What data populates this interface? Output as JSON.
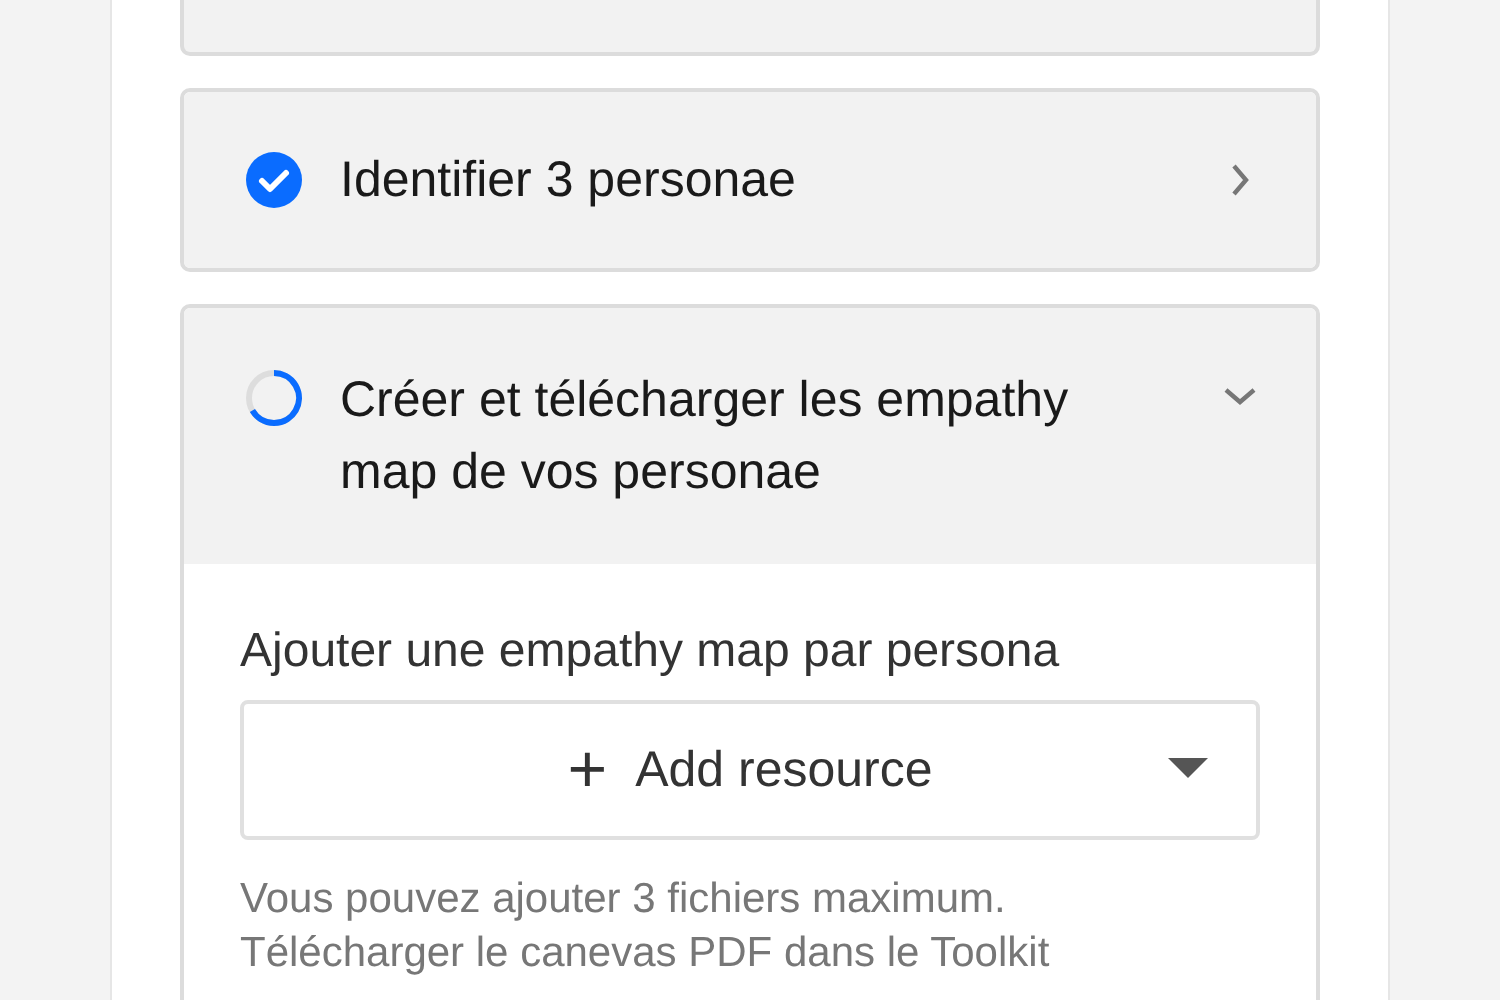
{
  "tasks": [
    {
      "title": "Identifier 3 personae",
      "completed": true,
      "expanded": false
    },
    {
      "title": "Créer et télécharger les empathy map de vos personae",
      "completed": false,
      "expanded": true,
      "body": {
        "label": "Ajouter une empathy map par persona",
        "dropdown": {
          "icon": "+",
          "label": "Add resource"
        },
        "help": "Vous pouvez ajouter 3 fichiers maximum. Télécharger le canevas PDF dans le Toolkit"
      }
    }
  ]
}
